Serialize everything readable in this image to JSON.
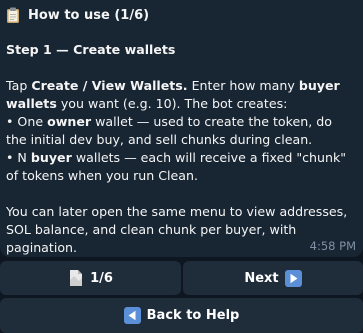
{
  "message": {
    "title": "How to use (1/6)",
    "step_title": "Step 1 — Create wallets",
    "para1_pre": "Tap ",
    "para1_bold": "Create / View Wallets.",
    "para1_mid": " Enter how many ",
    "para1_bold2": "buyer wallets",
    "para1_post": " you want (e.g. 10). The bot creates:",
    "bullet1_pre": "• One ",
    "bullet1_bold": "owner",
    "bullet1_post": " wallet — used to create the token, do the initial dev buy, and sell chunks during clean.",
    "bullet2_pre": "• N ",
    "bullet2_bold": "buyer",
    "bullet2_post": " wallets — each will receive a fixed \"chunk\" of tokens when you run Clean.",
    "para2": "You can later open the same menu to view addresses, SOL balance, and clean chunk per buyer, with pagination.",
    "time": "4:58 PM"
  },
  "keyboard": {
    "page_label": "1/6",
    "next_label": "Next",
    "back_label": "Back to Help"
  },
  "icons": {
    "title_icon": "clipboard-icon",
    "page_icon": "page-document-icon",
    "next_icon": "play-right-arrow-icon",
    "back_icon": "left-arrow-icon"
  },
  "colors": {
    "background": "#0e1621",
    "bubble": "#182533",
    "button": "#1f2c3a",
    "icon_blue": "#5b8fd8"
  }
}
